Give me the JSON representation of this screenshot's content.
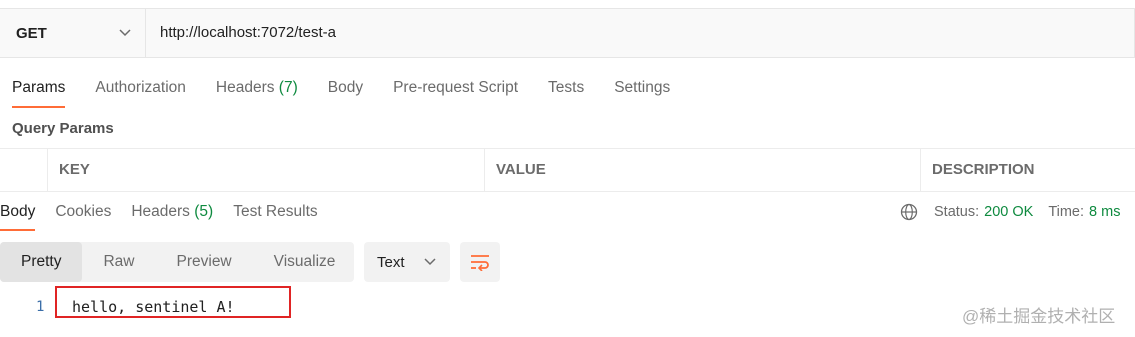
{
  "request": {
    "method": "GET",
    "url": "http://localhost:7072/test-a"
  },
  "request_tabs": [
    {
      "label": "Params",
      "count": ""
    },
    {
      "label": "Authorization",
      "count": ""
    },
    {
      "label": "Headers",
      "count": "(7)"
    },
    {
      "label": "Body",
      "count": ""
    },
    {
      "label": "Pre-request Script",
      "count": ""
    },
    {
      "label": "Tests",
      "count": ""
    },
    {
      "label": "Settings",
      "count": ""
    }
  ],
  "query_params": {
    "title": "Query Params",
    "columns": [
      "KEY",
      "VALUE",
      "DESCRIPTION"
    ]
  },
  "response_tabs": [
    {
      "label": "Body",
      "count": ""
    },
    {
      "label": "Cookies",
      "count": ""
    },
    {
      "label": "Headers",
      "count": "(5)"
    },
    {
      "label": "Test Results",
      "count": ""
    }
  ],
  "status": {
    "status_label": "Status:",
    "status_value": "200 OK",
    "time_label": "Time:",
    "time_value": "8 ms"
  },
  "view_modes": [
    "Pretty",
    "Raw",
    "Preview",
    "Visualize"
  ],
  "format": "Text",
  "response_body": {
    "line_number": "1",
    "text": "hello, sentinel A!"
  },
  "watermark": "@稀土掘金技术社区",
  "colors": {
    "accent": "#ff6c37",
    "success": "#0e8a3f",
    "highlight_box": "#e02424"
  },
  "icons": [
    "chevron-down-icon",
    "globe-icon",
    "wrap-lines-icon"
  ]
}
